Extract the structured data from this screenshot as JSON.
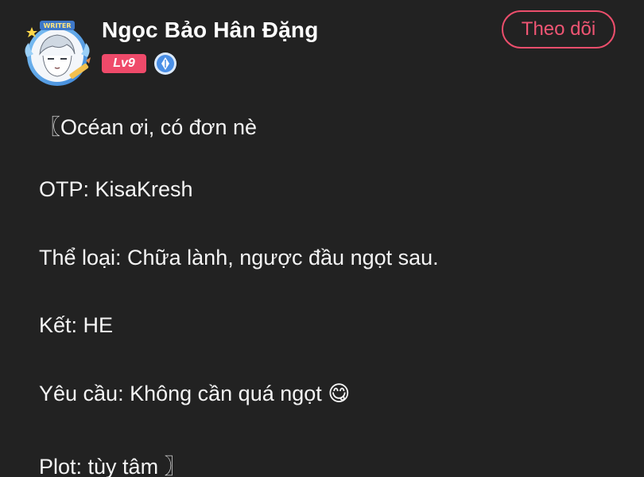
{
  "author": {
    "name": "Ngọc Bảo Hân Đặng",
    "level": "Lv9",
    "avatar_badge": "WRITER"
  },
  "follow_button": {
    "label": "Theo dõi"
  },
  "post": {
    "lines": [
      "〖Océan ơi, có đơn nè",
      "OTP: KisaKresh",
      "Thể loại: Chữa lành, ngược đầu ngọt sau.",
      "Kết: HE",
      "Yêu cầu: Không cần quá ngọt 😋",
      "Plot: tùy tâm 〗"
    ]
  },
  "icons": {
    "avatar": "writer-avatar-icon",
    "verified": "verified-writer-badge-icon"
  },
  "colors": {
    "background": "#222222",
    "accent": "#ef4a6a",
    "text": "#f4f4f4",
    "badge_blue": "#4a8fe6"
  }
}
